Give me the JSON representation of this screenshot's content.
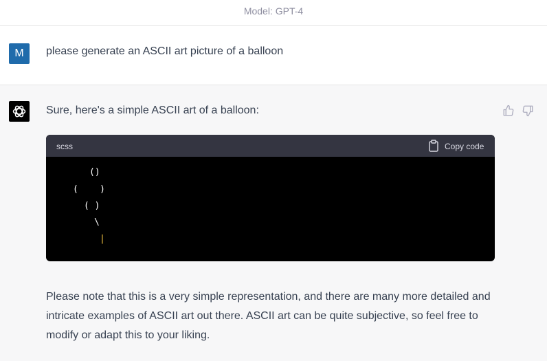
{
  "header": {
    "model_label": "Model: GPT-4"
  },
  "user_message": {
    "avatar_letter": "M",
    "text": "please generate an ASCII art picture of a balloon",
    "avatar_color": "#1f6bab"
  },
  "assistant_message": {
    "intro": "Sure, here's a simple ASCII art of a balloon:",
    "code_block": {
      "language": "scss",
      "copy_label": "Copy code",
      "lines": [
        "()",
        "(    )",
        "( )",
        "\\",
        "|"
      ]
    },
    "closing_paragraph": "Please note that this is a very simple representation, and there are many more detailed and intricate examples of ASCII art out there. ASCII art can be quite subjective, so feel free to modify or adapt this to your liking."
  },
  "icons": {
    "assistant_avatar": "openai-logo-icon",
    "feedback_up": "thumbs-up-icon",
    "feedback_down": "thumbs-down-icon",
    "copy": "clipboard-icon"
  }
}
